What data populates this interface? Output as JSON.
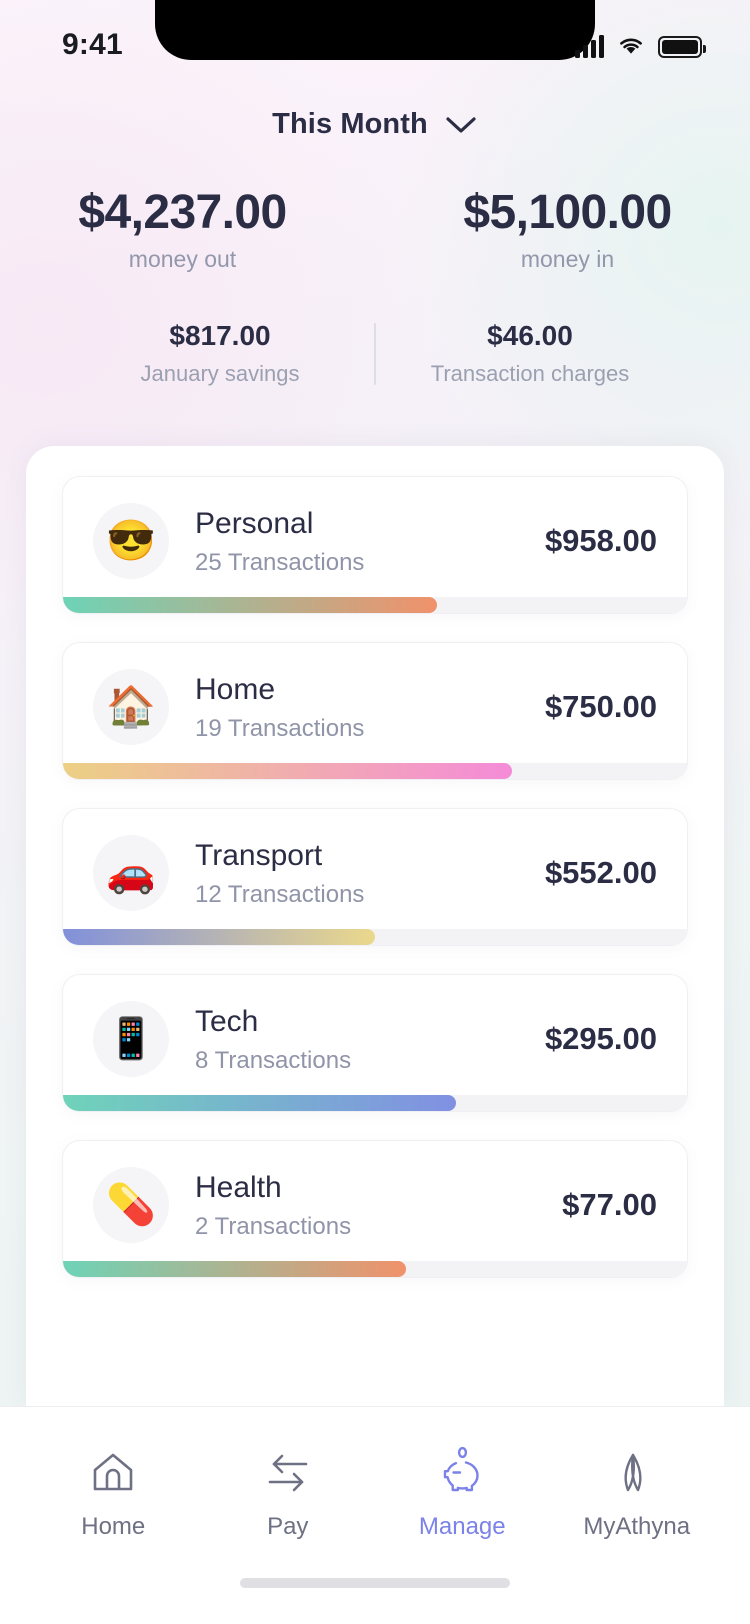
{
  "status_bar": {
    "time": "9:41",
    "signal_icon": "cellular-signal-icon",
    "wifi_icon": "wifi-icon",
    "battery_icon": "battery-icon"
  },
  "header": {
    "period_label": "This Month",
    "chevron_icon": "chevron-down-icon",
    "totals": [
      {
        "amount": "$4,237.00",
        "label": "money out"
      },
      {
        "amount": "$5,100.00",
        "label": "money in"
      }
    ],
    "subtotals": [
      {
        "amount": "$817.00",
        "label": "January savings"
      },
      {
        "amount": "$46.00",
        "label": "Transaction charges"
      }
    ]
  },
  "categories": [
    {
      "name": "Personal",
      "emoji": "😎",
      "emoji_name": "smiling-face-with-sunglasses-icon",
      "transactions": "25 Transactions",
      "amount": "$958.00",
      "progress_pct": 60,
      "gradient_from": "#6ed3b6",
      "gradient_to": "#f0926b"
    },
    {
      "name": "Home",
      "emoji": "🏠",
      "emoji_name": "house-icon",
      "transactions": "19 Transactions",
      "amount": "$750.00",
      "progress_pct": 72,
      "gradient_from": "#ecd084",
      "gradient_to": "#f58bd8"
    },
    {
      "name": "Transport",
      "emoji": "🚗",
      "emoji_name": "car-icon",
      "transactions": "12 Transactions",
      "amount": "$552.00",
      "progress_pct": 50,
      "gradient_from": "#8190db",
      "gradient_to": "#ebd88c"
    },
    {
      "name": "Tech",
      "emoji": "📱",
      "emoji_name": "mobile-phone-icon",
      "transactions": "8 Transactions",
      "amount": "$295.00",
      "progress_pct": 63,
      "gradient_from": "#6fd3ba",
      "gradient_to": "#8190e3"
    },
    {
      "name": "Health",
      "emoji": "💊",
      "emoji_name": "pill-icon",
      "transactions": "2 Transactions",
      "amount": "$77.00",
      "progress_pct": 55,
      "gradient_from": "#6ed3b6",
      "gradient_to": "#f0926b"
    }
  ],
  "bottom_nav": {
    "active_color": "#7b82e8",
    "items": [
      {
        "label": "Home",
        "icon": "home-icon",
        "active": false
      },
      {
        "label": "Pay",
        "icon": "transfer-arrows-icon",
        "active": false
      },
      {
        "label": "Manage",
        "icon": "piggy-bank-icon",
        "active": true
      },
      {
        "label": "MyAthyna",
        "icon": "athyna-leaf-icon",
        "active": false
      }
    ]
  }
}
